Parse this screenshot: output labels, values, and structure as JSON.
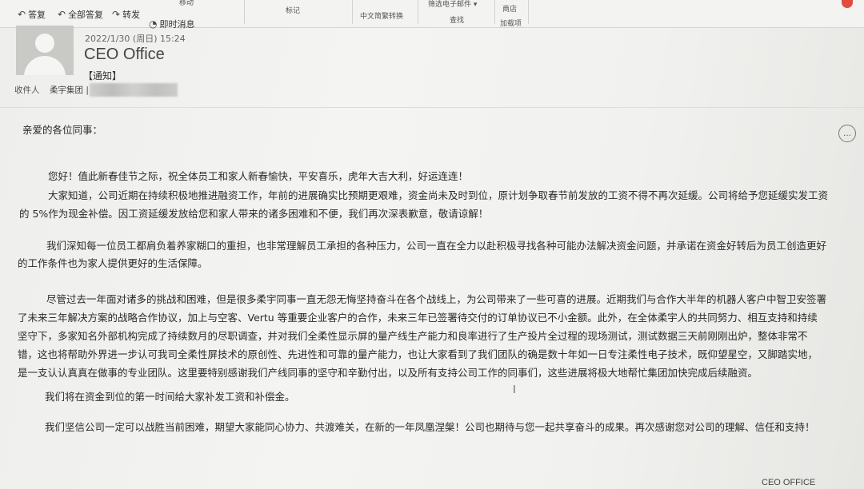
{
  "ribbon": {
    "quick_actions": [
      {
        "label": "答复",
        "icon": "reply-icon"
      },
      {
        "label": "全部答复",
        "icon": "reply-all-icon"
      },
      {
        "label": "转发",
        "icon": "forward-icon"
      },
      {
        "label": "即时消息",
        "icon": "instant-message-icon"
      }
    ],
    "groups": {
      "move": "移动",
      "tags": "标记",
      "chinese_convert": "中文简繁转换",
      "filter_email": "筛选电子邮件 ▾",
      "find": "查找",
      "store": "商店",
      "addins": "加载项"
    }
  },
  "header": {
    "date": "2022/1/30 (周日) 15:24",
    "sender": "CEO Office",
    "subject": "【通知】",
    "recipients_label": "收件人",
    "recipient_org": "柔宇集团 |"
  },
  "body": {
    "greeting": "亲爱的各位同事：",
    "lines": [
      "您好！值此新春佳节之际，祝全体员工和家人新春愉快，平安喜乐，虎年大吉大利，好运连连！",
      "大家知道，公司近期在持续积极地推进融资工作，年前的进展确实比预期更艰难，资金尚未及时到位，原计划争取春节前发放的工资不得不再次延缓。公司将给予您延缓实发工资",
      "的 5%作为现金补偿。因工资延缓发放给您和家人带来的诸多困难和不便，我们再次深表歉意，敬请谅解！",
      "我们深知每一位员工都肩负着养家糊口的重担，也非常理解员工承担的各种压力，公司一直在全力以赴积极寻找各种可能办法解决资金问题，并承诺在资金好转后为员工创造更好",
      "的工作条件也为家人提供更好的生活保障。",
      "尽管过去一年面对诸多的挑战和困难，但是很多柔宇同事一直无怨无悔坚持奋斗在各个战线上，为公司带来了一些可喜的进展。近期我们与合作大半年的机器人客户中智卫安签署",
      "了未来三年解决方案的战略合作协议，加上与空客、Vertu 等重要企业客户的合作，未来三年已签署待交付的订单协议已不小金额。此外，在全体柔宇人的共同努力、相互支持和持续",
      "坚守下，多家知名外部机构完成了持续数月的尽职调查，并对我们全柔性显示屏的量产线生产能力和良率进行了生产投片全过程的现场测试，测试数据三天前刚刚出炉，整体非常不",
      "错，这也将帮助外界进一步认可我司全柔性屏技术的原创性、先进性和可靠的量产能力，也让大家看到了我们团队的确是数十年如一日专注柔性电子技术，既仰望星空，又脚踏实地，",
      "是一支认认真真在做事的专业团队。这里要特别感谢我们产线同事的坚守和辛勤付出，以及所有支持公司工作的同事们，这些进展将极大地帮忙集团加快完成后续融资。",
      "我们将在资金到位的第一时间给大家补发工资和补偿金。",
      "我们坚信公司一定可以战胜当前困难，期望大家能同心协力、共渡难关，在新的一年凤凰涅槃！公司也期待与您一起共享奋斗的成果。再次感谢您对公司的理解、信任和支持！"
    ],
    "signature": "CEO OFFICE"
  }
}
